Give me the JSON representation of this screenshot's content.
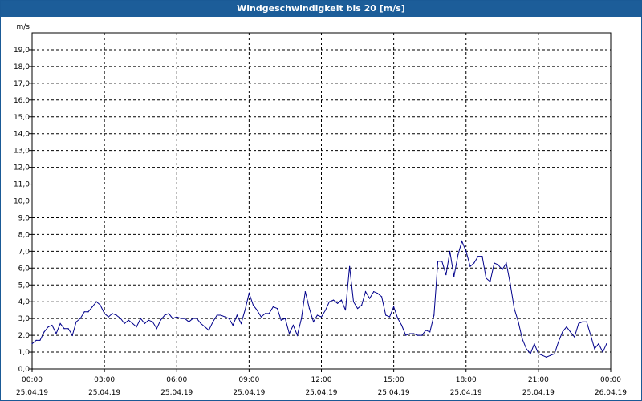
{
  "window": {
    "title": "Windgeschwindigkeit bis 20 [m/s]"
  },
  "chart_data": {
    "type": "line",
    "title": "Windgeschwindigkeit bis 20 [m/s]",
    "unit_label": "m/s",
    "ylim": [
      0,
      20
    ],
    "xlim_hours": [
      0,
      24
    ],
    "grid": true,
    "y_ticks": [
      "0,0",
      "1,0",
      "2,0",
      "3,0",
      "4,0",
      "5,0",
      "6,0",
      "7,0",
      "8,0",
      "9,0",
      "10,0",
      "11,0",
      "12,0",
      "13,0",
      "14,0",
      "15,0",
      "16,0",
      "17,0",
      "18,0",
      "19,0"
    ],
    "x_ticks": [
      {
        "time": "00:00",
        "date": "25.04.19"
      },
      {
        "time": "03:00",
        "date": "25.04.19"
      },
      {
        "time": "06:00",
        "date": "25.04.19"
      },
      {
        "time": "09:00",
        "date": "25.04.19"
      },
      {
        "time": "12:00",
        "date": "25.04.19"
      },
      {
        "time": "15:00",
        "date": "25.04.19"
      },
      {
        "time": "18:00",
        "date": "25.04.19"
      },
      {
        "time": "21:00",
        "date": "25.04.19"
      },
      {
        "time": "00:00",
        "date": "26.04.19"
      }
    ],
    "line_color": "#00008b",
    "series": [
      {
        "x": [
          0,
          0.17,
          0.33,
          0.5,
          0.67,
          0.83,
          1,
          1.17,
          1.33,
          1.5,
          1.67,
          1.83,
          2,
          2.17,
          2.33,
          2.5,
          2.67,
          2.83,
          3,
          3.17,
          3.33,
          3.5,
          3.67,
          3.83,
          4,
          4.17,
          4.33,
          4.5,
          4.67,
          4.83,
          5,
          5.17,
          5.33,
          5.5,
          5.67,
          5.83,
          6,
          6.17,
          6.33,
          6.5,
          6.67,
          6.83,
          7,
          7.17,
          7.33,
          7.5,
          7.67,
          7.83,
          8,
          8.17,
          8.33,
          8.5,
          8.67,
          8.83,
          9,
          9.17,
          9.33,
          9.5,
          9.67,
          9.83,
          10,
          10.17,
          10.33,
          10.5,
          10.67,
          10.83,
          11,
          11.17,
          11.33,
          11.5,
          11.67,
          11.83,
          12,
          12.17,
          12.33,
          12.5,
          12.67,
          12.83,
          13,
          13.17,
          13.33,
          13.5,
          13.67,
          13.83,
          14,
          14.17,
          14.33,
          14.5,
          14.67,
          14.83,
          15,
          15.17,
          15.33,
          15.5,
          15.67,
          15.83,
          16,
          16.17,
          16.33,
          16.5,
          16.67,
          16.83,
          17,
          17.17,
          17.33,
          17.5,
          17.67,
          17.83,
          18,
          18.17,
          18.33,
          18.5,
          18.67,
          18.83,
          19,
          19.17,
          19.33,
          19.5,
          19.67,
          19.83,
          20,
          20.17,
          20.33,
          20.5,
          20.67,
          20.83,
          21,
          21.17,
          21.33,
          21.5,
          21.67,
          21.83,
          22,
          22.17,
          22.33,
          22.5,
          22.67,
          22.83,
          23,
          23.17,
          23.33,
          23.5,
          23.67,
          23.83
        ],
        "values": [
          1.5,
          1.7,
          1.7,
          2.2,
          2.5,
          2.6,
          2.1,
          2.7,
          2.4,
          2.4,
          2.0,
          2.8,
          3.0,
          3.4,
          3.4,
          3.7,
          4.0,
          3.8,
          3.3,
          3.1,
          3.3,
          3.2,
          3.0,
          2.7,
          2.9,
          2.7,
          2.5,
          3.0,
          2.7,
          2.9,
          2.8,
          2.4,
          2.9,
          3.2,
          3.3,
          3.0,
          3.1,
          3.0,
          3.0,
          2.8,
          3.0,
          3.0,
          2.7,
          2.5,
          2.3,
          2.8,
          3.2,
          3.2,
          3.1,
          3.0,
          2.6,
          3.2,
          2.7,
          3.5,
          4.5,
          3.8,
          3.5,
          3.1,
          3.3,
          3.3,
          3.7,
          3.6,
          2.9,
          3.0,
          2.1,
          2.6,
          2.0,
          3.0,
          4.6,
          3.6,
          2.8,
          3.2,
          3.1,
          3.5,
          4.0,
          4.1,
          3.9,
          4.1,
          3.5,
          6.1,
          4.0,
          3.6,
          3.8,
          4.6,
          4.2,
          4.6,
          4.5,
          4.3,
          3.2,
          3.1,
          3.7,
          3.0,
          2.6,
          2.0,
          2.1,
          2.1,
          2.0,
          2.0,
          2.3,
          2.2,
          3.2,
          6.4,
          6.4,
          5.6,
          7.0,
          5.5,
          6.8,
          7.6,
          7.0,
          6.1,
          6.3,
          6.7,
          6.7,
          5.4,
          5.2,
          6.3,
          6.2,
          5.9,
          6.3,
          5.1,
          3.6,
          2.8,
          1.8,
          1.2,
          0.9,
          1.5,
          0.9,
          0.8,
          0.7,
          0.8,
          0.9,
          1.6,
          2.2,
          2.5,
          2.2,
          1.9,
          2.7,
          2.8,
          2.8,
          2.0,
          1.2,
          1.5,
          1.0,
          1.5
        ]
      }
    ]
  }
}
